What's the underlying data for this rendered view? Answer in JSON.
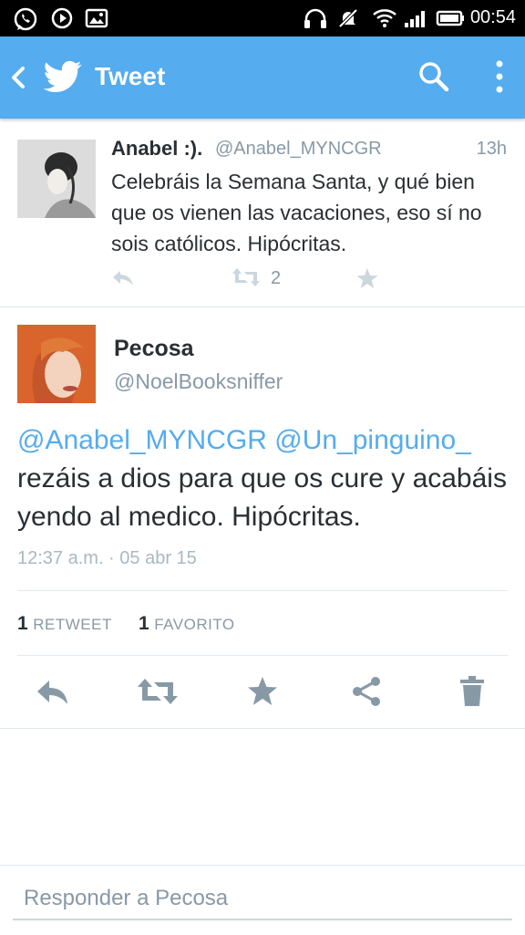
{
  "status_bar": {
    "time": "00:54"
  },
  "app_bar": {
    "title": "Tweet"
  },
  "previous_tweet": {
    "name": "Anabel :).",
    "handle": "@Anabel_MYNCGR",
    "time": "13h",
    "text": "Celebráis la Semana Santa, y qué bien que os vienen las vacaciones, eso sí no sois católicos. Hipócritas.",
    "retweet_count": "2"
  },
  "main_tweet": {
    "name": "Pecosa",
    "handle": "@NoelBooksniffer",
    "mention1": "@Anabel_MYNCGR",
    "mention2": "@Un_pinguino_",
    "text": "rezáis a dios para que os cure y acabáis yendo al medico. Hipócritas.",
    "timestamp": "12:37 a.m. · 05 abr 15",
    "retweets_count": "1",
    "retweets_label": "RETWEET",
    "favorites_count": "1",
    "favorites_label": "FAVORITO"
  },
  "reply": {
    "placeholder": "Responder a Pecosa"
  },
  "colors": {
    "accent": "#55acee",
    "text": "#292f33",
    "muted": "#8899a6"
  }
}
